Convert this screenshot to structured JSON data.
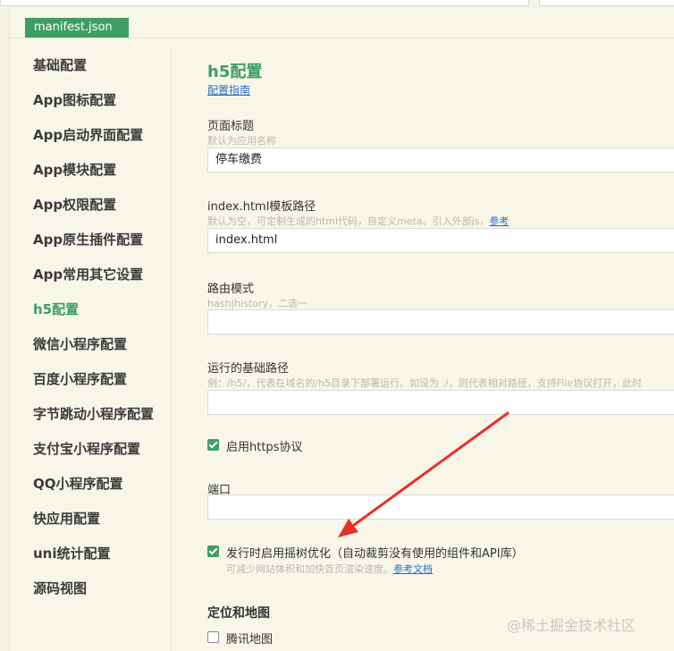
{
  "tab": {
    "label": "manifest.json"
  },
  "sidebar": {
    "items": [
      {
        "label": "基础配置"
      },
      {
        "label": "App图标配置"
      },
      {
        "label": "App启动界面配置"
      },
      {
        "label": "App模块配置"
      },
      {
        "label": "App权限配置"
      },
      {
        "label": "App原生插件配置"
      },
      {
        "label": "App常用其它设置"
      },
      {
        "label": "h5配置",
        "active": true
      },
      {
        "label": "微信小程序配置"
      },
      {
        "label": "百度小程序配置"
      },
      {
        "label": "字节跳动小程序配置"
      },
      {
        "label": "支付宝小程序配置"
      },
      {
        "label": "QQ小程序配置"
      },
      {
        "label": "快应用配置"
      },
      {
        "label": "uni统计配置"
      },
      {
        "label": "源码视图"
      }
    ]
  },
  "main": {
    "title": "h5配置",
    "guide_link": "配置指南",
    "page_title": {
      "label": "页面标题",
      "hint": "默认为应用名称",
      "value": "停车缴费"
    },
    "template_path": {
      "label": "index.html模板路径",
      "hint": "默认为空，可定制生成的html代码，自定义meta、引入外部js，",
      "hint_link": "参考",
      "value": "index.html"
    },
    "router_mode": {
      "label": "路由模式",
      "hint": "hash|history，二选一",
      "value": ""
    },
    "base_path": {
      "label": "运行的基础路径",
      "hint": "例：/h5/，代表在域名的/h5目录下部署运行。如设为 ./，则代表相对路径，支持File协议打开，此时",
      "value": ""
    },
    "https": {
      "label": "启用https协议",
      "checked": true
    },
    "port": {
      "label": "端口",
      "value": ""
    },
    "tree_shaking": {
      "label": "发行时启用摇树优化（自动裁剪没有使用的组件和API库）",
      "hint": "可减少网站体积和加快首页渲染速度。",
      "hint_link": "参考文档",
      "checked": true
    },
    "map_section": "定位和地图",
    "tencent_map": {
      "label": "腾讯地图",
      "checked": false
    }
  },
  "watermark": "@稀土掘金技术社区",
  "colors": {
    "accent": "#3f9e63",
    "link": "#2a6fc9",
    "arrow": "#e8312a"
  }
}
